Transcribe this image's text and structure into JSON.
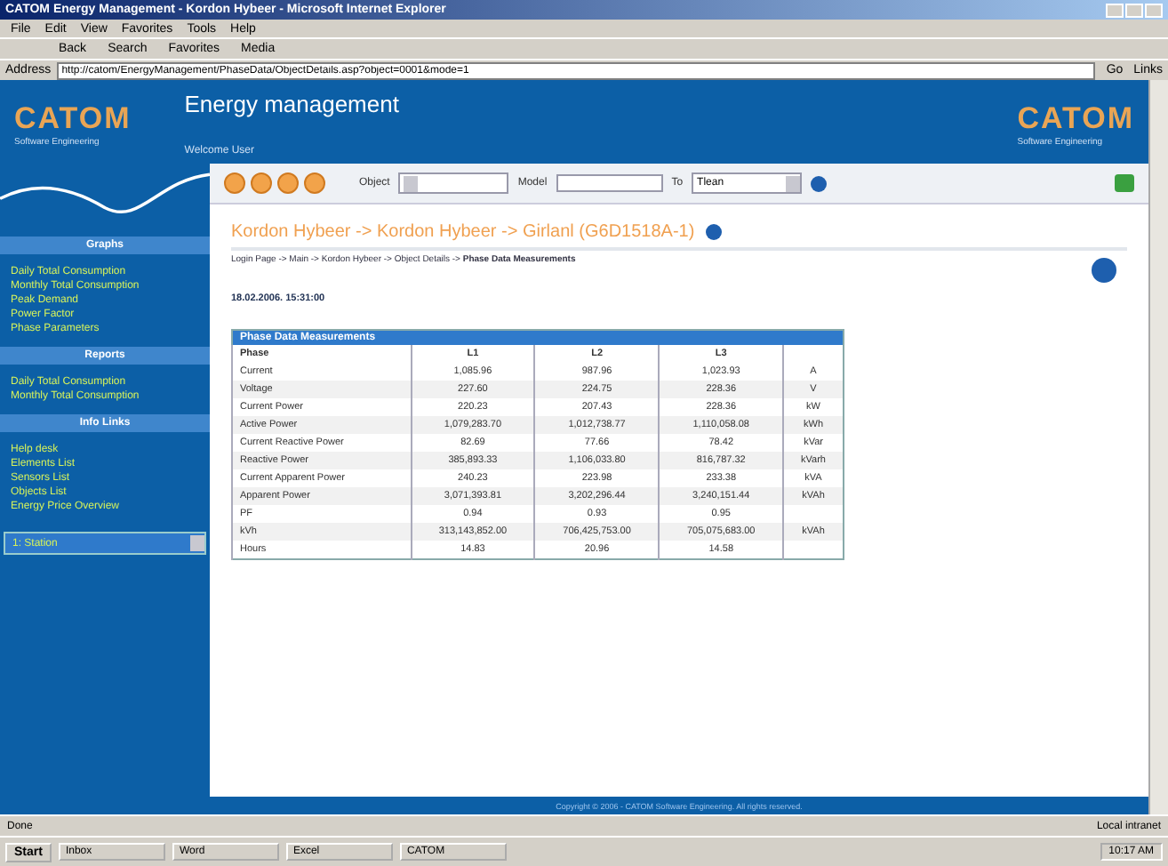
{
  "browser": {
    "title": "CATOM Energy Management - Kordon Hybeer - Microsoft Internet Explorer",
    "menu": [
      "File",
      "Edit",
      "View",
      "Favorites",
      "Tools",
      "Help"
    ],
    "toolbar": [
      "Back",
      "Search",
      "Favorites",
      "Media"
    ],
    "address_label": "Address",
    "url": "http://catom/EnergyManagement/PhaseData/ObjectDetails.asp?object=0001&mode=1",
    "go": "Go",
    "links": "Links"
  },
  "header": {
    "logos": [
      {
        "name": "CATOM",
        "tagline": "Software Engineering"
      },
      {
        "name": "CATOM",
        "tagline": "Software Engineering"
      }
    ],
    "title": "Energy management",
    "user": "Welcome User"
  },
  "filters": {
    "object_label": "Object",
    "model_label": "Model",
    "to_label": "To",
    "to_value": "Tlean"
  },
  "sidebar": [
    {
      "title": "Graphs",
      "items": [
        "Daily Total Consumption",
        "Monthly Total Consumption",
        "Peak Demand",
        "Power Factor",
        "Phase Parameters"
      ]
    },
    {
      "title": "Reports",
      "items": [
        "Daily Total Consumption",
        "Monthly Total Consumption"
      ]
    },
    {
      "title": "Info Links",
      "items": [
        "Help desk",
        "Elements List",
        "Sensors List",
        "Objects List",
        "Energy Price Overview"
      ]
    }
  ],
  "station_select": "1: Station",
  "content": {
    "heading": "Kordon Hybeer -> Kordon Hybeer -> Girlanl (G6D1518A-1)",
    "breadcrumb": "Login Page -> Main -> Kordon Hybeer -> Object Details -> **Phase Data Measurements**",
    "date": "18.02.2006. 15:31:00",
    "table": {
      "title": "Phase Data Measurements",
      "columns": [
        "Phase",
        "L1",
        "L2",
        "L3"
      ],
      "rows": [
        [
          "Current",
          "1,085.96",
          "987.96",
          "1,023.93",
          "A"
        ],
        [
          "Voltage",
          "227.60",
          "224.75",
          "228.36",
          "V"
        ],
        [
          "Current Power",
          "220.23",
          "207.43",
          "228.36",
          "kW"
        ],
        [
          "Active Power",
          "1,079,283.70",
          "1,012,738.77",
          "1,110,058.08",
          "kWh"
        ],
        [
          "Current Reactive Power",
          "82.69",
          "77.66",
          "78.42",
          "kVar"
        ],
        [
          "Reactive Power",
          "385,893.33",
          "1,106,033.80",
          "816,787.32",
          "kVarh"
        ],
        [
          "Current Apparent Power",
          "240.23",
          "223.98",
          "233.38",
          "kVA"
        ],
        [
          "Apparent Power",
          "3,071,393.81",
          "3,202,296.44",
          "3,240,151.44",
          "kVAh"
        ],
        [
          "PF",
          "0.94",
          "0.93",
          "0.95",
          ""
        ],
        [
          "kVh",
          "313,143,852.00",
          "706,425,753.00",
          "705,075,683.00",
          "kVAh"
        ],
        [
          "Hours",
          "14.83",
          "20.96",
          "14.58",
          ""
        ]
      ]
    }
  },
  "footer": "Copyright © 2006 - CATOM Software Engineering. All rights reserved.",
  "status": {
    "text": "Done",
    "zone": "Local intranet"
  },
  "taskbar": {
    "start": "Start",
    "tasks": [
      "Inbox",
      "Word",
      "Excel",
      "CATOM"
    ],
    "clock": "10:17 AM"
  }
}
